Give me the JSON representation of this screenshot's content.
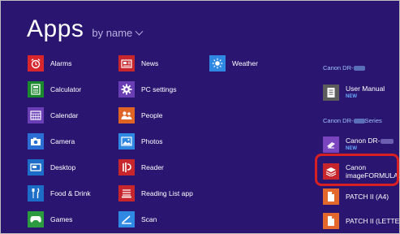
{
  "header": {
    "title": "Apps",
    "sort_label": "by name"
  },
  "columns": [
    [
      {
        "label": "Alarms",
        "icon": "alarm-clock-icon",
        "color": "#d8262d"
      },
      {
        "label": "Calculator",
        "icon": "calculator-icon",
        "color": "#1b8a2e"
      },
      {
        "label": "Calendar",
        "icon": "calendar-icon",
        "color": "#6a3fb6"
      },
      {
        "label": "Camera",
        "icon": "camera-icon",
        "color": "#2b6fd6"
      },
      {
        "label": "Desktop",
        "icon": "desktop-icon",
        "color": "#1c6dc7"
      },
      {
        "label": "Food & Drink",
        "icon": "fork-knife-icon",
        "color": "#1c6dc7"
      },
      {
        "label": "Games",
        "icon": "gamepad-icon",
        "color": "#1b8a2e"
      }
    ],
    [
      {
        "label": "News",
        "icon": "news-icon",
        "color": "#c8262d"
      },
      {
        "label": "PC settings",
        "icon": "gear-icon",
        "color": "#6a3fb6"
      },
      {
        "label": "People",
        "icon": "people-icon",
        "color": "#e06424"
      },
      {
        "label": "Photos",
        "icon": "photo-icon",
        "color": "#2f89e3"
      },
      {
        "label": "Reader",
        "icon": "reader-icon",
        "color": "#c8262d"
      },
      {
        "label": "Reading List app",
        "icon": "reading-list-icon",
        "color": "#c8262d"
      },
      {
        "label": "Scan",
        "icon": "scan-icon",
        "color": "#2f89e3"
      }
    ],
    [
      {
        "label": "Weather",
        "icon": "sun-icon",
        "color": "#2f89e3"
      }
    ]
  ],
  "groups": [
    {
      "heading": "Canon DR-",
      "items": [
        {
          "label": "User Manual",
          "badge": "NEW",
          "icon": "document-icon",
          "color": "#5c5c5c"
        }
      ]
    },
    {
      "heading_prefix": "Canon DR-",
      "heading_suffix": "Series",
      "items": [
        {
          "label": "Canon DR-",
          "badge": "NEW",
          "icon": "scanner-icon",
          "color": "#7a44bf"
        },
        {
          "label_line1": "Canon",
          "label_line2": "imageFORMULA...",
          "icon": "imageformula-icon",
          "color": "#c8262d",
          "highlighted": true
        },
        {
          "label": "PATCH II (A4)",
          "icon": "patch-document-icon",
          "color": "#e2682b"
        },
        {
          "label": "PATCH II (LETTER)",
          "icon": "patch-document-icon",
          "color": "#e2682b"
        }
      ]
    }
  ]
}
